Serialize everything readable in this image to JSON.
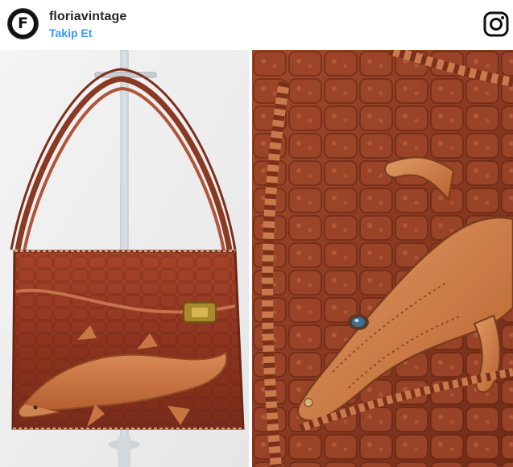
{
  "post": {
    "username": "floriavintage",
    "follow_label": "Takip Et",
    "avatar_letter": "F"
  },
  "icons": {
    "avatar": "brand-logo-icon",
    "platform": "instagram-icon"
  },
  "images": {
    "left": "leather handbag with alligator on front, on stand",
    "right": "close-up of alligator head on handbag"
  },
  "colors": {
    "link": "#3897f0",
    "text": "#262626",
    "leather": "#9a3b1f",
    "gator": "#c96a3a"
  }
}
